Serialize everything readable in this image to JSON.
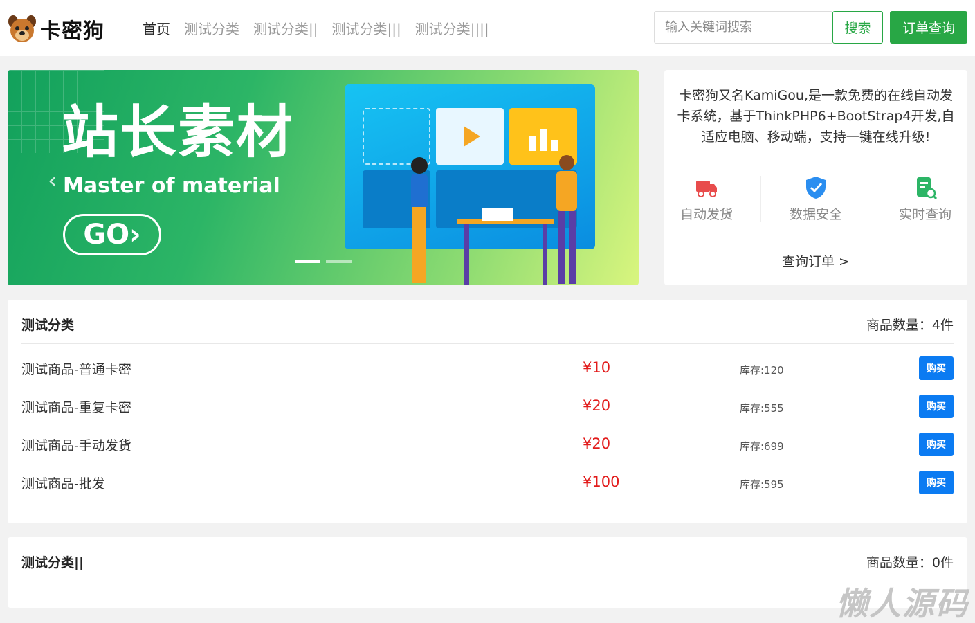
{
  "header": {
    "logo_text": "卡密狗",
    "nav": [
      {
        "label": "首页",
        "active": true
      },
      {
        "label": "测试分类",
        "active": false
      },
      {
        "label": "测试分类||",
        "active": false
      },
      {
        "label": "测试分类|||",
        "active": false
      },
      {
        "label": "测试分类||||",
        "active": false
      }
    ],
    "search_placeholder": "输入关键词搜索",
    "search_label": "搜索",
    "order_query_label": "订单查询"
  },
  "banner": {
    "title": "站长素材",
    "subtitle": "Master of material",
    "cta": "GO",
    "prev_arrow": "‹",
    "next_arrow": "›",
    "slides": 2,
    "active_slide": 1
  },
  "info": {
    "description": "卡密狗又名KamiGou,是一款免费的在线自动发卡系统，基于ThinkPHP6+BootStrap4开发,自适应电脑、移动端，支持一键在线升级!",
    "features": [
      {
        "label": "自动发货",
        "icon": "truck-icon",
        "color": "#e84c4c"
      },
      {
        "label": "数据安全",
        "icon": "shield-check-icon",
        "color": "#2b8ef0"
      },
      {
        "label": "实时查询",
        "icon": "document-search-icon",
        "color": "#2cb566"
      }
    ],
    "query_link": "查询订单 >"
  },
  "categories": [
    {
      "title": "测试分类",
      "count_label": "商品数量：4件",
      "products": [
        {
          "name": "测试商品-普通卡密",
          "price": "¥10",
          "stock": "库存:120",
          "buy": "购买"
        },
        {
          "name": "测试商品-重复卡密",
          "price": "¥20",
          "stock": "库存:555",
          "buy": "购买"
        },
        {
          "name": "测试商品-手动发货",
          "price": "¥20",
          "stock": "库存:699",
          "buy": "购买"
        },
        {
          "name": "测试商品-批发",
          "price": "¥100",
          "stock": "库存:595",
          "buy": "购买"
        }
      ]
    },
    {
      "title": "测试分类||",
      "count_label": "商品数量：0件",
      "products": []
    }
  ],
  "watermark": "懒人源码",
  "colors": {
    "primary_green": "#28a745",
    "price_red": "#e21b1b",
    "buy_blue": "#0b7bf2"
  }
}
